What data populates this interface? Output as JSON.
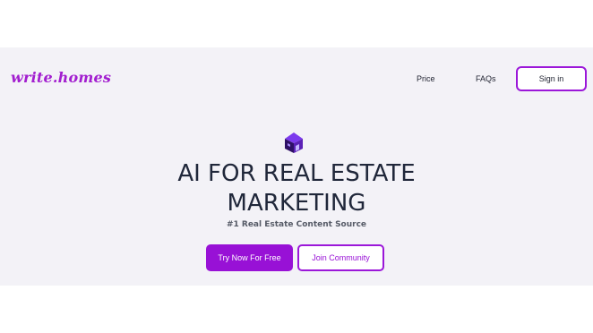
{
  "brand": {
    "logo_text": "write.homes",
    "accent_color": "#9811d6"
  },
  "nav": {
    "items": [
      {
        "label": "Price"
      },
      {
        "label": "FAQs"
      }
    ],
    "signin_label": "Sign in"
  },
  "hero": {
    "icon": "house-icon",
    "title_line1": "AI FOR REAL ESTATE",
    "title_line2": "MARKETING",
    "subtitle": "#1 Real Estate Content Source",
    "primary_cta": "Try Now For Free",
    "secondary_cta": "Join Community"
  }
}
